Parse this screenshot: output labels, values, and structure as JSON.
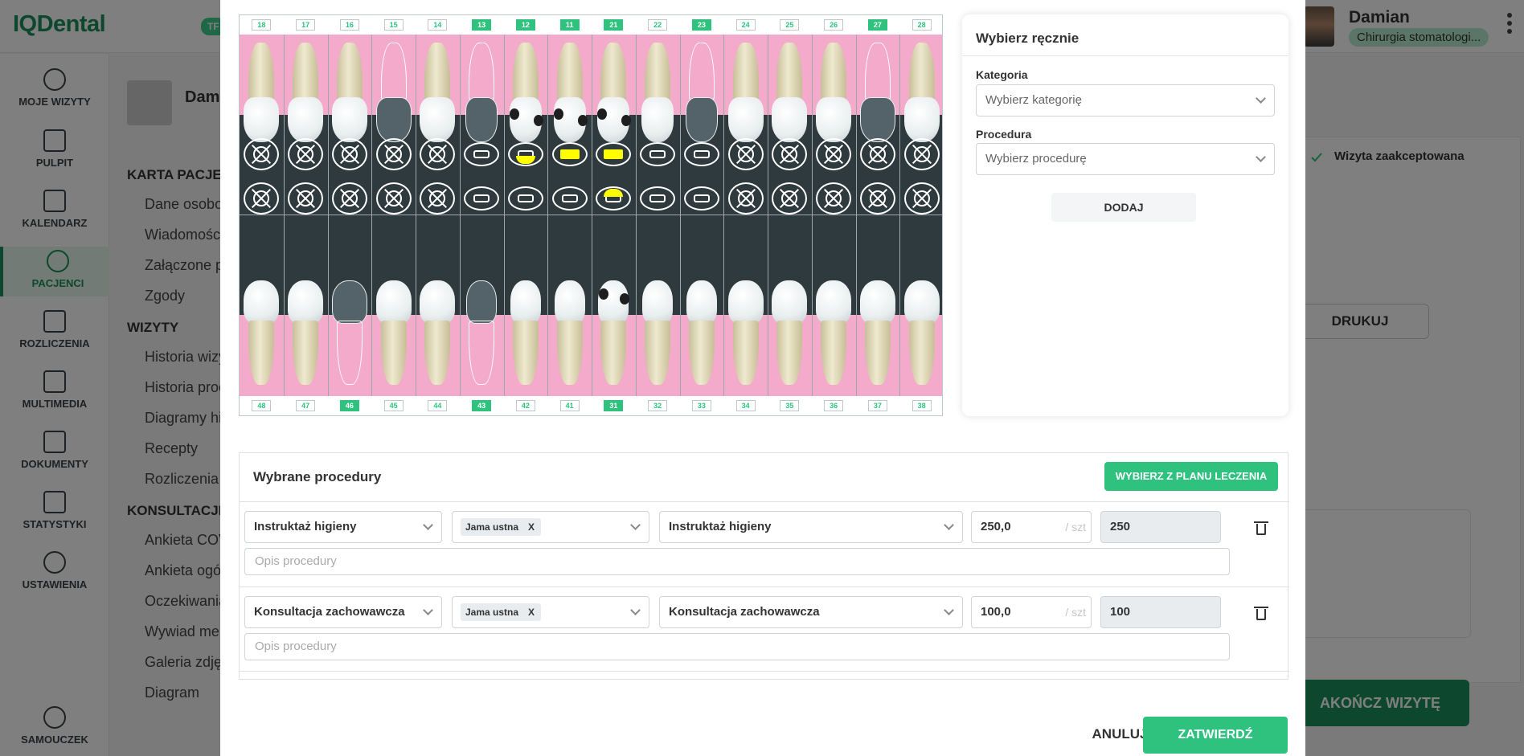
{
  "app": {
    "logo": "IQDental",
    "logo_badge": "TF"
  },
  "user": {
    "name": "Damian",
    "role": "Chirurgia stomatologi..."
  },
  "nav": [
    {
      "label": "MOJE WIZYTY",
      "icon": "play-circle-icon"
    },
    {
      "label": "PULPIT",
      "icon": "dashboard-icon"
    },
    {
      "label": "KALENDARZ",
      "icon": "calendar-icon"
    },
    {
      "label": "PACJENCI",
      "icon": "patients-icon",
      "active": true
    },
    {
      "label": "ROZLICZENIA",
      "icon": "credit-card-icon"
    },
    {
      "label": "MULTIMEDIA",
      "icon": "video-icon"
    },
    {
      "label": "DOKUMENTY",
      "icon": "document-icon"
    },
    {
      "label": "STATYSTYKI",
      "icon": "chart-icon"
    },
    {
      "label": "USTAWIENIA",
      "icon": "gear-icon"
    },
    {
      "label": "SAMOUCZEK",
      "icon": "help-icon"
    }
  ],
  "patient": {
    "name": "Dam",
    "sections": [
      {
        "title": "KARTA PACJEN",
        "links": [
          "Dane osobo",
          "Wiadomośc",
          "Załączone p",
          "Zgody"
        ]
      },
      {
        "title": "WIZYTY",
        "links": [
          "Historia wizy",
          "Historia proc",
          "Diagramy hi",
          "Recepty",
          "Rozliczenia"
        ]
      },
      {
        "title": "KONSULTACJE",
        "links": [
          "Ankieta COV",
          "Ankieta ogó",
          "Oczekiwania",
          "Wywiad me",
          "Galeria zdję",
          "Diagram"
        ]
      }
    ]
  },
  "visit": {
    "accepted": "Wizyta zaakceptowana",
    "print": "DRUKUJ",
    "end": "AKOŃCZ WIZYTĘ"
  },
  "teeth": {
    "upper": [
      "18",
      "17",
      "16",
      "15",
      "14",
      "13",
      "12",
      "11",
      "21",
      "22",
      "23",
      "24",
      "25",
      "26",
      "27",
      "28"
    ],
    "lower": [
      "48",
      "47",
      "46",
      "45",
      "44",
      "43",
      "42",
      "41",
      "31",
      "32",
      "33",
      "34",
      "35",
      "36",
      "37",
      "38"
    ],
    "upper_selected": [
      "13",
      "12",
      "11",
      "21",
      "23",
      "27"
    ],
    "lower_selected": [
      "46",
      "43",
      "31"
    ]
  },
  "manual": {
    "title": "Wybierz ręcznie",
    "category_label": "Kategoria",
    "category_placeholder": "Wybierz kategorię",
    "procedure_label": "Procedura",
    "procedure_placeholder": "Wybierz procedurę",
    "add": "DODAJ"
  },
  "procedures": {
    "title": "Wybrane procedury",
    "plan_button": "WYBIERZ Z PLANU LECZENIA",
    "desc_placeholder": "Opis procedury",
    "unit": "/ szt",
    "rows": [
      {
        "category": "Instruktaż higieny",
        "area": "Jama ustna",
        "area_remove": "X",
        "procedure": "Instruktaż higieny",
        "price": "250,0",
        "total": "250"
      },
      {
        "category": "Konsultacja zachowawcza",
        "area": "Jama ustna",
        "area_remove": "X",
        "procedure": "Konsultacja zachowawcza",
        "price": "100,0",
        "total": "100"
      }
    ]
  },
  "footer": {
    "cancel": "ANULUJ",
    "confirm": "ZATWIERDŹ"
  }
}
